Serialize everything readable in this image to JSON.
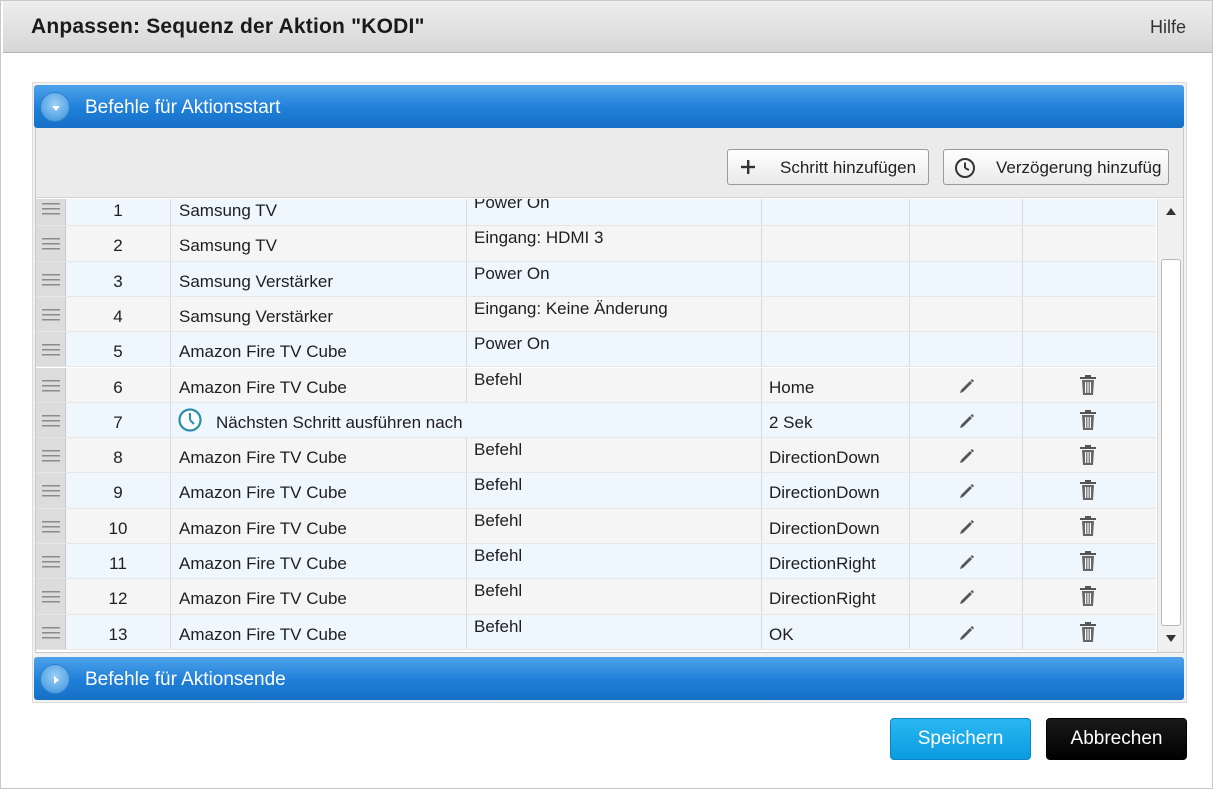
{
  "dialog": {
    "title": "Anpassen: Sequenz der Aktion \"KODI\"",
    "help_label": "Hilfe"
  },
  "sections": {
    "start_label": "Befehle für Aktionsstart",
    "end_label": "Befehle für Aktionsende"
  },
  "toolbar": {
    "add_step_label": "Schritt hinzufügen",
    "add_delay_label": "Verzögerung hinzufüg",
    "add_icon": "plus-icon",
    "delay_icon": "clock-icon"
  },
  "rows": [
    {
      "num": "1",
      "device": "Samsung TV",
      "command": "Power On",
      "value": "",
      "editable": false
    },
    {
      "num": "2",
      "device": "Samsung TV",
      "command": "Eingang: HDMI 3",
      "value": "",
      "editable": false
    },
    {
      "num": "3",
      "device": "Samsung Verstärker",
      "command": "Power On",
      "value": "",
      "editable": false
    },
    {
      "num": "4",
      "device": "Samsung Verstärker",
      "command": "Eingang: Keine Änderung",
      "value": "",
      "editable": false
    },
    {
      "num": "5",
      "device": "Amazon Fire TV Cube",
      "command": "Power On",
      "value": "",
      "editable": false
    },
    {
      "num": "6",
      "device": "Amazon Fire TV Cube",
      "command": "Befehl",
      "value": "Home",
      "editable": true
    },
    {
      "num": "7",
      "delay": true,
      "device": "Nächsten Schritt ausführen nach",
      "command": "",
      "value": "2 Sek",
      "editable": true
    },
    {
      "num": "8",
      "device": "Amazon Fire TV Cube",
      "command": "Befehl",
      "value": "DirectionDown",
      "editable": true
    },
    {
      "num": "9",
      "device": "Amazon Fire TV Cube",
      "command": "Befehl",
      "value": "DirectionDown",
      "editable": true
    },
    {
      "num": "10",
      "device": "Amazon Fire TV Cube",
      "command": "Befehl",
      "value": "DirectionDown",
      "editable": true
    },
    {
      "num": "11",
      "device": "Amazon Fire TV Cube",
      "command": "Befehl",
      "value": "DirectionRight",
      "editable": true
    },
    {
      "num": "12",
      "device": "Amazon Fire TV Cube",
      "command": "Befehl",
      "value": "DirectionRight",
      "editable": true
    },
    {
      "num": "13",
      "device": "Amazon Fire TV Cube",
      "command": "Befehl",
      "value": "OK",
      "editable": true
    }
  ],
  "footer": {
    "save_label": "Speichern",
    "cancel_label": "Abbrechen"
  },
  "colors": {
    "section_header": "#1f7fd8",
    "save_button": "#0a9be0",
    "cancel_button": "#000000",
    "row_even": "#eef6fe",
    "row_odd": "#f5f5f5"
  }
}
